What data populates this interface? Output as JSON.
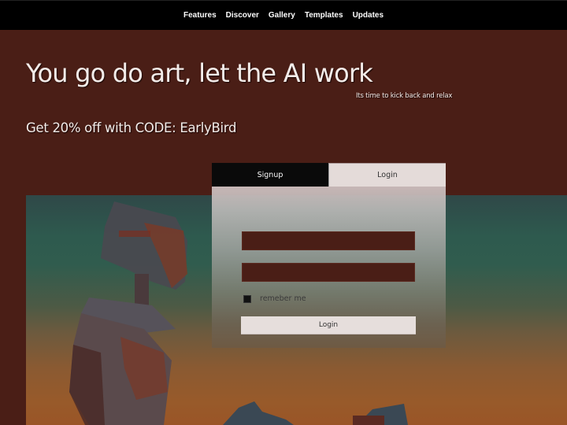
{
  "nav": {
    "items": [
      "Features",
      "Discover",
      "Gallery",
      "Templates",
      "Updates"
    ]
  },
  "hero": {
    "title": "You go do art, let the AI work",
    "subtitle": "Its time to kick back and relax",
    "promo": "Get 20% off with CODE: EarlyBird"
  },
  "artwork": {
    "description": "rusty robot figure against teal-to-orange sunset sky"
  },
  "auth": {
    "tabs": [
      {
        "label": "Signup",
        "active": false
      },
      {
        "label": "Login",
        "active": true
      }
    ],
    "username": {
      "value": "",
      "placeholder": ""
    },
    "password": {
      "value": "",
      "placeholder": ""
    },
    "remember_label": "remeber me",
    "remember_checked": false,
    "submit_label": "Login"
  },
  "colors": {
    "page_bg": "#4a1e16",
    "nav_bg": "#000000",
    "input_bg": "#4a1e16",
    "button_bg": "#e6dedc"
  }
}
